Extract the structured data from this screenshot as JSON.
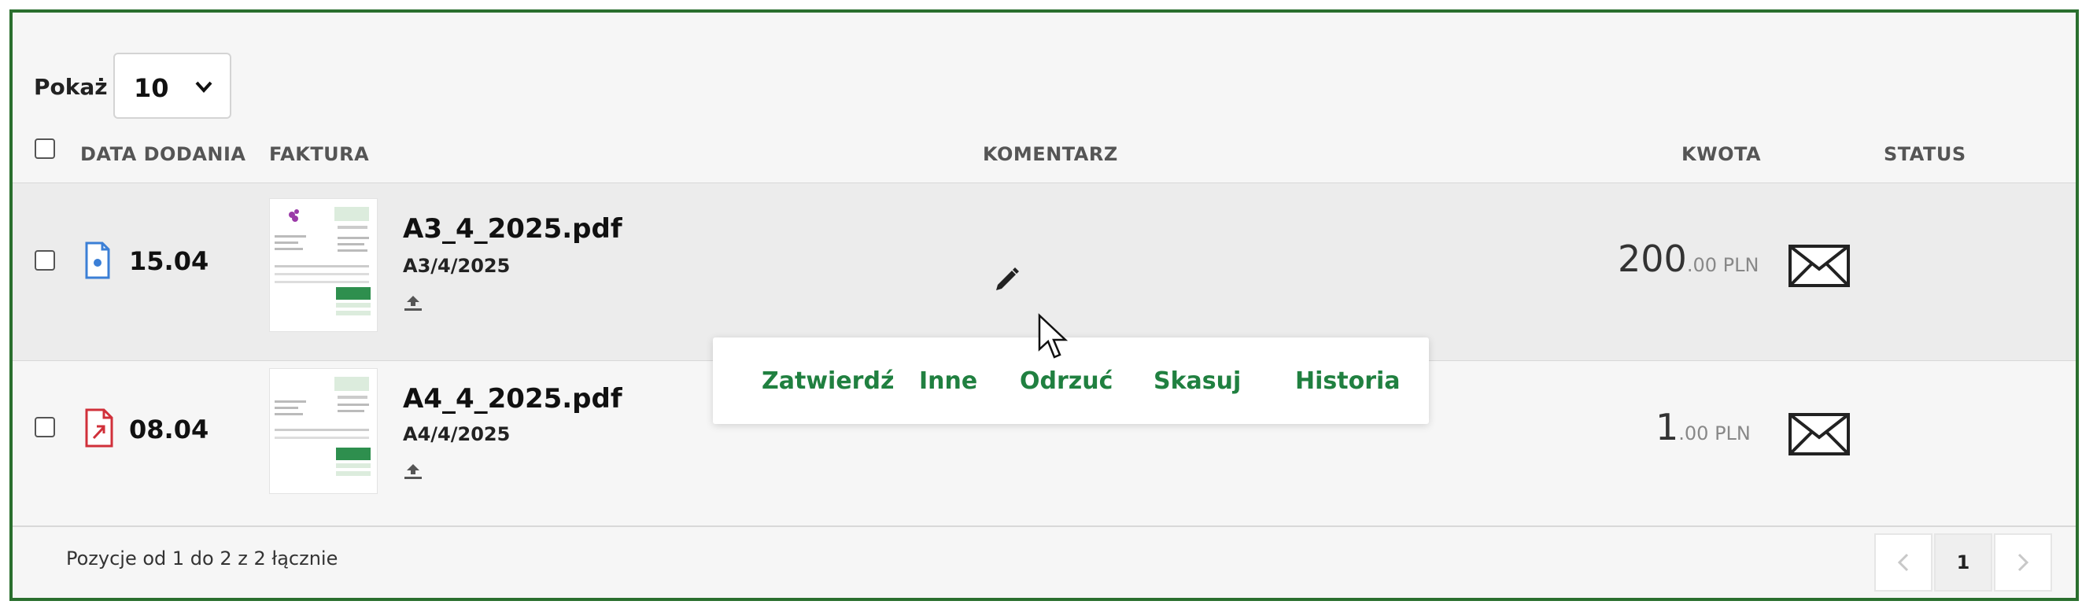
{
  "show": {
    "label": "Pokaż",
    "value": "10"
  },
  "table": {
    "headers": {
      "date": "DATA DODANIA",
      "invoice": "FAKTURA",
      "comment": "KOMENTARZ",
      "amount": "KWOTA",
      "status": "STATUS"
    },
    "rows": [
      {
        "date": "15.04",
        "file_name": "A3_4_2025.pdf",
        "invoice_number": "A3/4/2025",
        "amount_int": "200",
        "amount_dec": ".00 PLN",
        "file_icon": "document-icon",
        "file_icon_color": "#3b7fd6",
        "status_icon": "envelope-icon"
      },
      {
        "date": "08.04",
        "file_name": "A4_4_2025.pdf",
        "invoice_number": "A4/4/2025",
        "amount_int": "1",
        "amount_dec": ".00 PLN",
        "file_icon": "document-link-icon",
        "file_icon_color": "#d0303a",
        "status_icon": "envelope-icon"
      }
    ]
  },
  "action_menu": {
    "approve": "Zatwierdź",
    "other": "Inne",
    "reject": "Odrzuć",
    "delete": "Skasuj",
    "history": "Historia",
    "accent_color": "#208040"
  },
  "footer": {
    "summary": "Pozycje od 1 do 2 z 2 łącznie",
    "current_page": "1"
  }
}
